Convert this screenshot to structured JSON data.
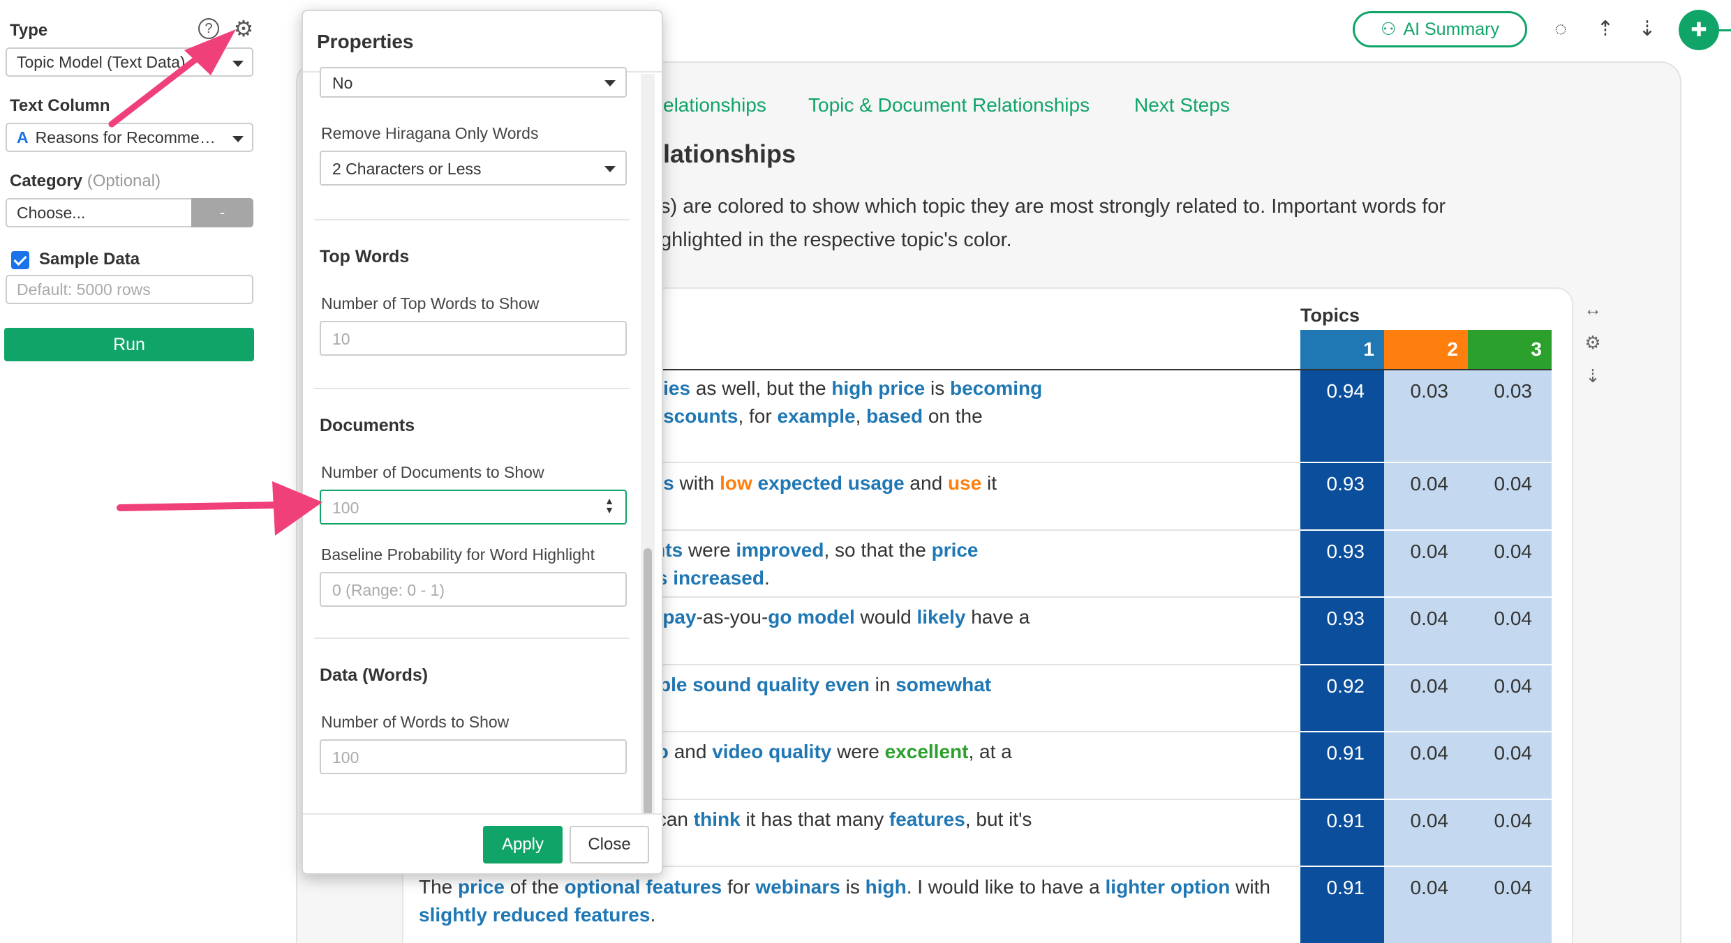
{
  "left_panel": {
    "type_label": "Type",
    "type_value": "Topic Model (Text Data)",
    "text_column_label": "Text Column",
    "text_column_icon": "A",
    "text_column_value": "Reasons for Recomme…",
    "category_label": "Category",
    "category_optional": "(Optional)",
    "category_value": "Choose...",
    "category_btn": "-",
    "sample_label": "Sample Data",
    "sample_placeholder": "Default: 5000 rows",
    "run_label": "Run"
  },
  "header": {
    "ai_summary_label": "AI Summary"
  },
  "report": {
    "tabs": [
      "elationships",
      "Topic & Document Relationships",
      "Next Steps"
    ],
    "section_title": "lationships",
    "description": [
      "s) are colored to show which topic they are most strongly related to. Important words for",
      "ghlighted in the respective topic's color."
    ],
    "topics_header": "Topics",
    "topic_numbers": [
      "1",
      "2",
      "3"
    ],
    "topic_colors": [
      "#1f77b4",
      "#ff7f0e",
      "#2ca02c"
    ],
    "rows": [
      {
        "values": [
          "0.94",
          "0.03",
          "0.03"
        ]
      },
      {
        "values": [
          "0.93",
          "0.04",
          "0.04"
        ]
      },
      {
        "values": [
          "0.93",
          "0.04",
          "0.04"
        ]
      },
      {
        "values": [
          "0.93",
          "0.04",
          "0.04"
        ]
      },
      {
        "values": [
          "0.92",
          "0.04",
          "0.04"
        ]
      },
      {
        "values": [
          "0.91",
          "0.04",
          "0.04"
        ]
      },
      {
        "values": [
          "0.91",
          "0.04",
          "0.04"
        ]
      },
      {
        "values": [
          "0.91",
          "0.04",
          "0.04"
        ]
      }
    ]
  },
  "dialog": {
    "title": "Properties",
    "top_select_value": "No",
    "hiragana_label": "Remove Hiragana Only Words",
    "hiragana_value": "2 Characters or Less",
    "top_words_heading": "Top Words",
    "top_words_label": "Number of Top Words to Show",
    "top_words_placeholder": "10",
    "documents_heading": "Documents",
    "documents_label": "Number of Documents to Show",
    "documents_placeholder": "100",
    "baseline_label": "Baseline Probability for Word Highlight",
    "baseline_placeholder": "0 (Range: 0 - 1)",
    "data_words_heading": "Data (Words)",
    "data_words_label": "Number of Words to Show",
    "data_words_placeholder": "100",
    "apply_label": "Apply",
    "close_label": "Close"
  },
  "colors": {
    "accent": "#10a468",
    "topic1_strong": "#0b4e9c",
    "topic_light": "#c4d9ef",
    "arrow": "#f0407a"
  }
}
